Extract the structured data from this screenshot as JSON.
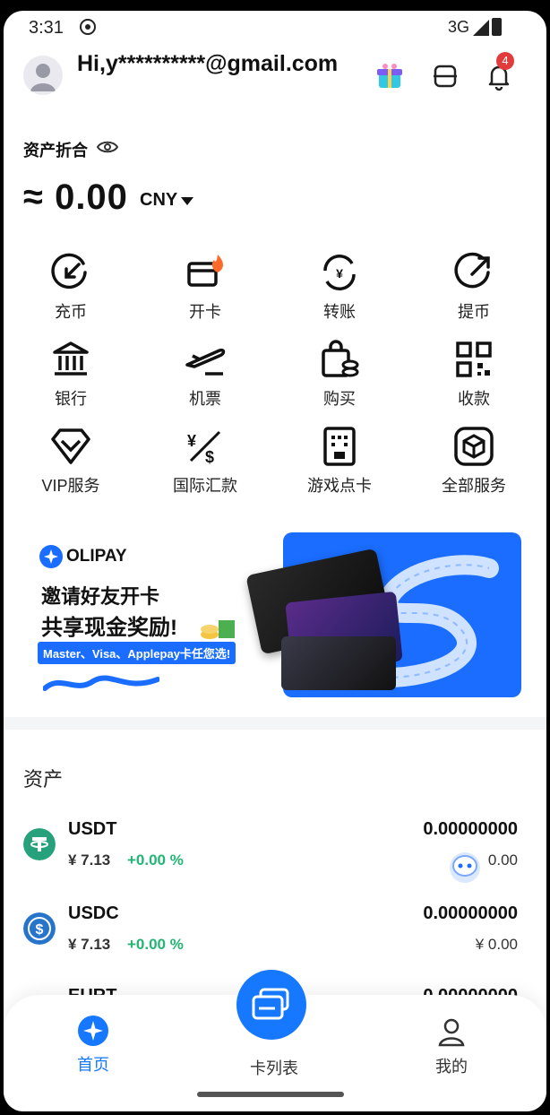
{
  "status_bar": {
    "time": "3:31",
    "network": "3G"
  },
  "header": {
    "greeting": "Hi,y**********@gmail.com",
    "notification_count": "4"
  },
  "balance": {
    "label": "资产折合",
    "amount": "≈ 0.00",
    "currency": "CNY"
  },
  "actions": [
    {
      "label": "充币",
      "icon": "deposit-icon"
    },
    {
      "label": "开卡",
      "icon": "open-card-icon"
    },
    {
      "label": "转账",
      "icon": "transfer-icon"
    },
    {
      "label": "提币",
      "icon": "withdraw-icon"
    },
    {
      "label": "银行",
      "icon": "bank-icon"
    },
    {
      "label": "机票",
      "icon": "flight-icon"
    },
    {
      "label": "购买",
      "icon": "buy-icon"
    },
    {
      "label": "收款",
      "icon": "qr-receive-icon"
    },
    {
      "label": "VIP服务",
      "icon": "vip-icon"
    },
    {
      "label": "国际汇款",
      "icon": "remittance-icon"
    },
    {
      "label": "游戏点卡",
      "icon": "game-card-icon"
    },
    {
      "label": "全部服务",
      "icon": "all-services-icon"
    }
  ],
  "banner": {
    "brand": "OLIPAY",
    "line1": "邀请好友开卡",
    "line2": "共享现金奖励!",
    "pill": "Master、Visa、Applepay卡任您选!"
  },
  "assets": {
    "title": "资产",
    "items": [
      {
        "symbol": "USDT",
        "price": "¥ 7.13",
        "change": "+0.00 %",
        "amount": "0.00000000",
        "value": "0.00",
        "color": "#26a17b"
      },
      {
        "symbol": "USDC",
        "price": "¥ 7.13",
        "change": "+0.00 %",
        "amount": "0.00000000",
        "value": "¥ 0.00",
        "color": "#2775ca"
      },
      {
        "symbol": "EURT",
        "price": "",
        "change": "",
        "amount": "0.00000000",
        "value": "",
        "color": "#1a8cff"
      }
    ]
  },
  "nav": {
    "home": "首页",
    "cards": "卡列表",
    "mine": "我的"
  },
  "colors": {
    "accent": "#1677ff",
    "positive": "#22b573",
    "badge": "#e23b3b"
  }
}
